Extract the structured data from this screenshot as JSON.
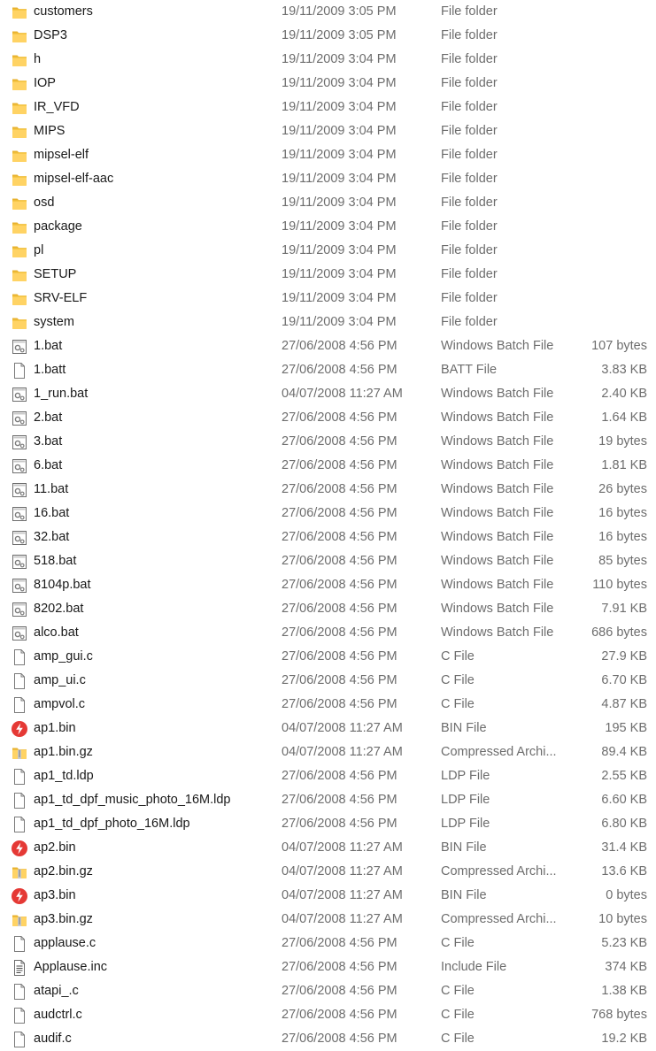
{
  "files": [
    {
      "name": "customers",
      "date": "19/11/2009 3:05 PM",
      "type": "File folder",
      "size": "",
      "icon": "folder-icon"
    },
    {
      "name": "DSP3",
      "date": "19/11/2009 3:05 PM",
      "type": "File folder",
      "size": "",
      "icon": "folder-icon"
    },
    {
      "name": "h",
      "date": "19/11/2009 3:04 PM",
      "type": "File folder",
      "size": "",
      "icon": "folder-icon"
    },
    {
      "name": "IOP",
      "date": "19/11/2009 3:04 PM",
      "type": "File folder",
      "size": "",
      "icon": "folder-icon"
    },
    {
      "name": "IR_VFD",
      "date": "19/11/2009 3:04 PM",
      "type": "File folder",
      "size": "",
      "icon": "folder-icon"
    },
    {
      "name": "MIPS",
      "date": "19/11/2009 3:04 PM",
      "type": "File folder",
      "size": "",
      "icon": "folder-icon"
    },
    {
      "name": "mipsel-elf",
      "date": "19/11/2009 3:04 PM",
      "type": "File folder",
      "size": "",
      "icon": "folder-icon"
    },
    {
      "name": "mipsel-elf-aac",
      "date": "19/11/2009 3:04 PM",
      "type": "File folder",
      "size": "",
      "icon": "folder-icon"
    },
    {
      "name": "osd",
      "date": "19/11/2009 3:04 PM",
      "type": "File folder",
      "size": "",
      "icon": "folder-icon"
    },
    {
      "name": "package",
      "date": "19/11/2009 3:04 PM",
      "type": "File folder",
      "size": "",
      "icon": "folder-icon"
    },
    {
      "name": "pl",
      "date": "19/11/2009 3:04 PM",
      "type": "File folder",
      "size": "",
      "icon": "folder-icon"
    },
    {
      "name": "SETUP",
      "date": "19/11/2009 3:04 PM",
      "type": "File folder",
      "size": "",
      "icon": "folder-icon"
    },
    {
      "name": "SRV-ELF",
      "date": "19/11/2009 3:04 PM",
      "type": "File folder",
      "size": "",
      "icon": "folder-icon"
    },
    {
      "name": "system",
      "date": "19/11/2009 3:04 PM",
      "type": "File folder",
      "size": "",
      "icon": "folder-icon"
    },
    {
      "name": "1.bat",
      "date": "27/06/2008 4:56 PM",
      "type": "Windows Batch File",
      "size": "107 bytes",
      "icon": "batch-file-icon"
    },
    {
      "name": "1.batt",
      "date": "27/06/2008 4:56 PM",
      "type": "BATT File",
      "size": "3.83 KB",
      "icon": "blank-file-icon"
    },
    {
      "name": "1_run.bat",
      "date": "04/07/2008 11:27 AM",
      "type": "Windows Batch File",
      "size": "2.40 KB",
      "icon": "batch-file-icon"
    },
    {
      "name": "2.bat",
      "date": "27/06/2008 4:56 PM",
      "type": "Windows Batch File",
      "size": "1.64 KB",
      "icon": "batch-file-icon"
    },
    {
      "name": "3.bat",
      "date": "27/06/2008 4:56 PM",
      "type": "Windows Batch File",
      "size": "19 bytes",
      "icon": "batch-file-icon"
    },
    {
      "name": "6.bat",
      "date": "27/06/2008 4:56 PM",
      "type": "Windows Batch File",
      "size": "1.81 KB",
      "icon": "batch-file-icon"
    },
    {
      "name": "11.bat",
      "date": "27/06/2008 4:56 PM",
      "type": "Windows Batch File",
      "size": "26 bytes",
      "icon": "batch-file-icon"
    },
    {
      "name": "16.bat",
      "date": "27/06/2008 4:56 PM",
      "type": "Windows Batch File",
      "size": "16 bytes",
      "icon": "batch-file-icon"
    },
    {
      "name": "32.bat",
      "date": "27/06/2008 4:56 PM",
      "type": "Windows Batch File",
      "size": "16 bytes",
      "icon": "batch-file-icon"
    },
    {
      "name": "518.bat",
      "date": "27/06/2008 4:56 PM",
      "type": "Windows Batch File",
      "size": "85 bytes",
      "icon": "batch-file-icon"
    },
    {
      "name": "8104p.bat",
      "date": "27/06/2008 4:56 PM",
      "type": "Windows Batch File",
      "size": "110 bytes",
      "icon": "batch-file-icon"
    },
    {
      "name": "8202.bat",
      "date": "27/06/2008 4:56 PM",
      "type": "Windows Batch File",
      "size": "7.91 KB",
      "icon": "batch-file-icon"
    },
    {
      "name": "alco.bat",
      "date": "27/06/2008 4:56 PM",
      "type": "Windows Batch File",
      "size": "686 bytes",
      "icon": "batch-file-icon"
    },
    {
      "name": "amp_gui.c",
      "date": "27/06/2008 4:56 PM",
      "type": "C File",
      "size": "27.9 KB",
      "icon": "blank-file-icon"
    },
    {
      "name": "amp_ui.c",
      "date": "27/06/2008 4:56 PM",
      "type": "C File",
      "size": "6.70 KB",
      "icon": "blank-file-icon"
    },
    {
      "name": "ampvol.c",
      "date": "27/06/2008 4:56 PM",
      "type": "C File",
      "size": "4.87 KB",
      "icon": "blank-file-icon"
    },
    {
      "name": "ap1.bin",
      "date": "04/07/2008 11:27 AM",
      "type": "BIN File",
      "size": "195 KB",
      "icon": "bin-file-icon"
    },
    {
      "name": "ap1.bin.gz",
      "date": "04/07/2008 11:27 AM",
      "type": "Compressed Archi...",
      "size": "89.4 KB",
      "icon": "archive-file-icon"
    },
    {
      "name": "ap1_td.ldp",
      "date": "27/06/2008 4:56 PM",
      "type": "LDP File",
      "size": "2.55 KB",
      "icon": "blank-file-icon"
    },
    {
      "name": "ap1_td_dpf_music_photo_16M.ldp",
      "date": "27/06/2008 4:56 PM",
      "type": "LDP File",
      "size": "6.60 KB",
      "icon": "blank-file-icon"
    },
    {
      "name": "ap1_td_dpf_photo_16M.ldp",
      "date": "27/06/2008 4:56 PM",
      "type": "LDP File",
      "size": "6.80 KB",
      "icon": "blank-file-icon"
    },
    {
      "name": "ap2.bin",
      "date": "04/07/2008 11:27 AM",
      "type": "BIN File",
      "size": "31.4 KB",
      "icon": "bin-file-icon"
    },
    {
      "name": "ap2.bin.gz",
      "date": "04/07/2008 11:27 AM",
      "type": "Compressed Archi...",
      "size": "13.6 KB",
      "icon": "archive-file-icon"
    },
    {
      "name": "ap3.bin",
      "date": "04/07/2008 11:27 AM",
      "type": "BIN File",
      "size": "0 bytes",
      "icon": "bin-file-icon"
    },
    {
      "name": "ap3.bin.gz",
      "date": "04/07/2008 11:27 AM",
      "type": "Compressed Archi...",
      "size": "10 bytes",
      "icon": "archive-file-icon"
    },
    {
      "name": "applause.c",
      "date": "27/06/2008 4:56 PM",
      "type": "C File",
      "size": "5.23 KB",
      "icon": "blank-file-icon"
    },
    {
      "name": "Applause.inc",
      "date": "27/06/2008 4:56 PM",
      "type": "Include File",
      "size": "374 KB",
      "icon": "text-file-icon"
    },
    {
      "name": "atapi_.c",
      "date": "27/06/2008 4:56 PM",
      "type": "C File",
      "size": "1.38 KB",
      "icon": "blank-file-icon"
    },
    {
      "name": "audctrl.c",
      "date": "27/06/2008 4:56 PM",
      "type": "C File",
      "size": "768 bytes",
      "icon": "blank-file-icon"
    },
    {
      "name": "audif.c",
      "date": "27/06/2008 4:56 PM",
      "type": "C File",
      "size": "19.2 KB",
      "icon": "blank-file-icon"
    }
  ]
}
